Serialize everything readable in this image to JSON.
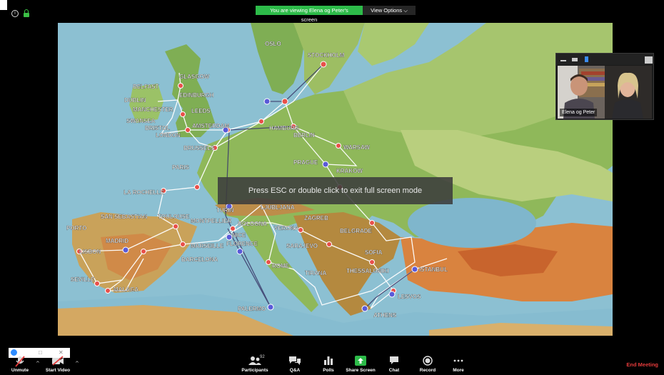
{
  "banner": {
    "viewing_text": "You are viewing Elena og Peter's screen",
    "view_options_label": "View Options ⌵"
  },
  "esc_hint": "Press ESC or double click to exit full screen mode",
  "video": {
    "participant_name": "Elena og Peter"
  },
  "map": {
    "cities": [
      "OSLO",
      "STOCKHOLM",
      "GLASGOW",
      "EDINBURGH",
      "BELFAST",
      "DUBLIN",
      "MANCHESTER",
      "SWANSEA",
      "BRISTOL",
      "LONDON",
      "LEEDS",
      "AMSTERDAM",
      "BRUSSELS",
      "HAMBURG",
      "BERLIN",
      "WARSAW",
      "PARIS",
      "PRAGUE",
      "KRAKOW",
      "LA ROCHELLE",
      "SAN SEBASTIAN",
      "TOULOUSE",
      "TURIN",
      "LJUBLJANA",
      "ZAGREB",
      "PORTO",
      "MADRID",
      "LISBON",
      "MONTPELLIER",
      "MARSEILLE",
      "NICE",
      "BOLOGNA",
      "FLORENCE",
      "VERONA",
      "BARCELONA",
      "BELGRADE",
      "SARAJEVO",
      "SOFIA",
      "ROME",
      "TIRANA",
      "THESSALONIKI",
      "ISTANBUL",
      "SEVILLE",
      "MALAGA",
      "LESVOS",
      "PALERMO",
      "ATHENS"
    ]
  },
  "toolbar": {
    "unmute": "Unmute",
    "start_video": "Start Video",
    "participants": "Participants",
    "participants_count": "92",
    "qa": "Q&A",
    "polls": "Polls",
    "share_screen": "Share Screen",
    "chat": "Chat",
    "record": "Record",
    "more": "More",
    "end_meeting": "End Meeting"
  },
  "colors": {
    "banner_green": "#2dbb49",
    "end_meeting_red": "#e53b3b",
    "share_green": "#2dbb49"
  }
}
